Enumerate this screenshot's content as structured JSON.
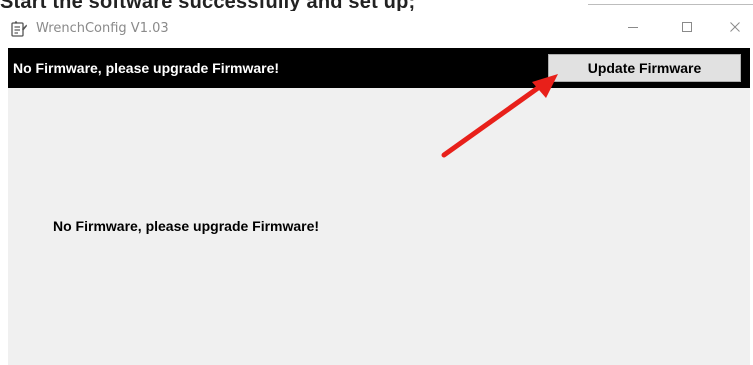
{
  "document_fragment": {
    "text": "Start the software successfully and set up;"
  },
  "window": {
    "title": "WrenchConfig V1.03",
    "icons": {
      "app": "app-icon",
      "minimize": "minimize-icon",
      "maximize": "maximize-icon",
      "close": "close-icon"
    }
  },
  "banner": {
    "message": "No Firmware, please upgrade Firmware!",
    "background": "#000000",
    "text_color": "#ffffff"
  },
  "toolbar": {
    "update_label": "Update Firmware"
  },
  "content": {
    "message": "No Firmware, please upgrade Firmware!",
    "background": "#f0f0f0"
  },
  "annotation": {
    "type": "arrow",
    "color": "#e8201a",
    "points_to": "update-firmware-button"
  }
}
